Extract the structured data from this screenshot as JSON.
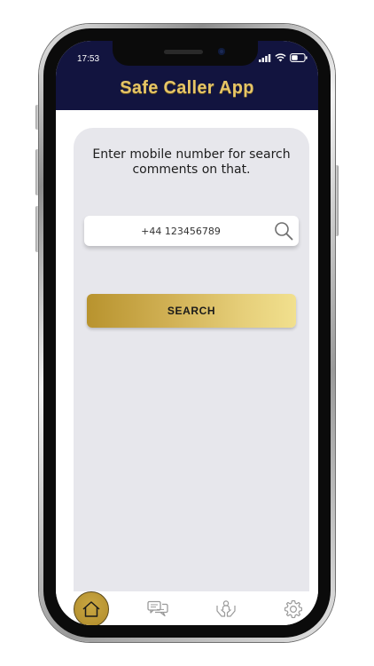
{
  "status_bar": {
    "time": "17:53",
    "icons": [
      "cellular-signal-icon",
      "wifi-icon",
      "battery-icon"
    ]
  },
  "header": {
    "title": "Safe Caller App"
  },
  "search_panel": {
    "prompt": "Enter mobile number for search comments on that.",
    "input_value": "+44 123456789",
    "search_icon": "magnifier-icon",
    "button_label": "SEARCH"
  },
  "bottom_nav": {
    "items": [
      {
        "icon": "home-icon",
        "active": true
      },
      {
        "icon": "comments-icon",
        "active": false
      },
      {
        "icon": "caring-hands-icon",
        "active": false
      },
      {
        "icon": "settings-gear-icon",
        "active": false
      }
    ]
  },
  "colors": {
    "header_bg": "#12143f",
    "title_gold": "#e6c566",
    "card_bg": "#e7e7ec",
    "button_gold_start": "#b8932e",
    "button_gold_end": "#f1e08e",
    "nav_active": "#c9a742",
    "nav_inactive_icon": "#9a9a9a"
  }
}
